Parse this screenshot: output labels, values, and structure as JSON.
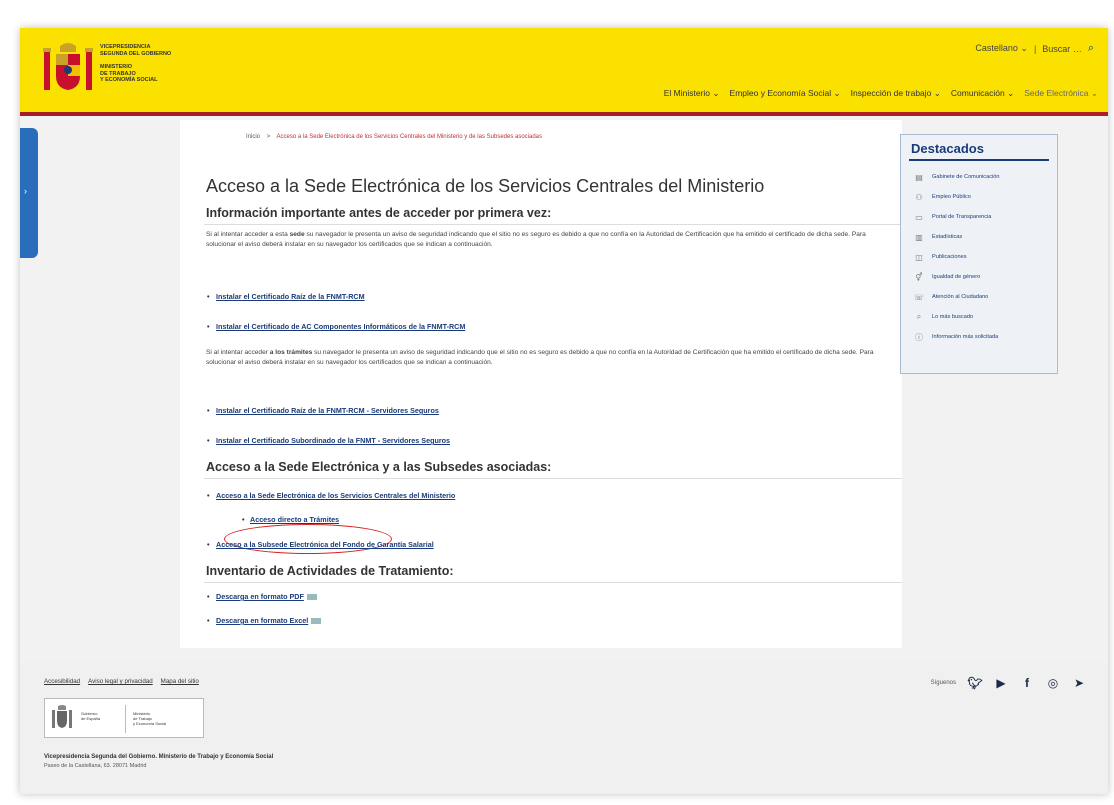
{
  "header": {
    "logo_lines_top": [
      "Vicepresidencia",
      "Segunda del Gobierno"
    ],
    "logo_lines_bottom": [
      "Ministerio",
      "de Trabajo",
      "y Economía Social"
    ],
    "language": "Castellano",
    "search": "Buscar",
    "nav": [
      "El Ministerio",
      "Empleo y Economía Social",
      "Inspección de trabajo",
      "Comunicación",
      "Sede Electrónica"
    ]
  },
  "breadcrumb": {
    "home": "Inicio",
    "sep": ">",
    "current": "Acceso a la Sede Electrónica de los Servicios Centrales del Ministerio y de las Subsedes asociadas"
  },
  "main": {
    "title": "Acceso a la Sede Electrónica de los Servicios Centrales del Ministerio",
    "section1": "Información importante antes de acceder por primera vez:",
    "para1_a": "Si al intentar acceder a esta ",
    "para1_b": "sede",
    "para1_c": " su navegador le presenta un aviso de seguridad indicando que el sitio no es seguro es debido a que no confía en la Autoridad de Certificación que ha emitido el certificado de dicha sede. Para solucionar el aviso deberá instalar en su navegador los certificados que se indican a continuación.",
    "link1": "Instalar el Certificado Raíz de la FNMT-RCM",
    "link2": "Instalar el Certificado de AC Componentes Informáticos de la FNMT-RCM",
    "para2_a": "Si al intentar acceder ",
    "para2_b": "a los trámites",
    "para2_c": " su navegador le presenta un aviso de seguridad indicando que el sitio no es seguro es debido a que no confía en la Autoridad de Certificación que ha emitido el certificado de dicha sede. Para solucionar el aviso deberá instalar en su navegador los certificados que se indican a continuación.",
    "link3": "Instalar el Certificado Raíz de la FNMT-RCM - Servidores Seguros",
    "link4": "Instalar el Certificado Subordinado de la FNMT - Servidores Seguros",
    "section2": "Acceso a la Sede Electrónica y a las Subsedes asociadas:",
    "link5": "Acceso a la Sede Electrónica de los Servicios Centrales del Ministerio",
    "sublink": "Acceso directo a Trámites",
    "link6": "Acceso a la Subsede Electrónica del Fondo de Garantía Salarial",
    "section3": "Inventario de Actividades de Tratamiento:",
    "link7": "Descarga en formato PDF",
    "link8": "Descarga en formato Excel"
  },
  "sidebar": {
    "title": "Destacados",
    "items": [
      {
        "label": "Gabinete de Comunicación",
        "icon": "newspaper-icon"
      },
      {
        "label": "Empleo Público",
        "icon": "people-icon"
      },
      {
        "label": "Portal de Transparencia",
        "icon": "transparency-icon"
      },
      {
        "label": "Estadísticas",
        "icon": "stats-icon"
      },
      {
        "label": "Publicaciones",
        "icon": "book-icon"
      },
      {
        "label": "Igualdad de género",
        "icon": "equality-icon"
      },
      {
        "label": "Atención al Ciudadano",
        "icon": "help-icon"
      },
      {
        "label": "Lo más buscado",
        "icon": "search-icon"
      },
      {
        "label": "Información más solicitada",
        "icon": "info-icon"
      }
    ]
  },
  "footer": {
    "links": [
      "Accesibilidad",
      "Aviso legal y privacidad",
      "Mapa del sitio"
    ],
    "logo_left": [
      "Gobierno",
      "de España"
    ],
    "logo_right": [
      "Ministerio",
      "de Trabajo",
      "y Economía Social"
    ],
    "address_title": "Vicepresidencia Segunda del Gobierno. Ministerio de Trabajo y Economía Social",
    "address": "Paseo de la Castellana, 63. 28071 Madrid",
    "follow": "Síguenos"
  }
}
